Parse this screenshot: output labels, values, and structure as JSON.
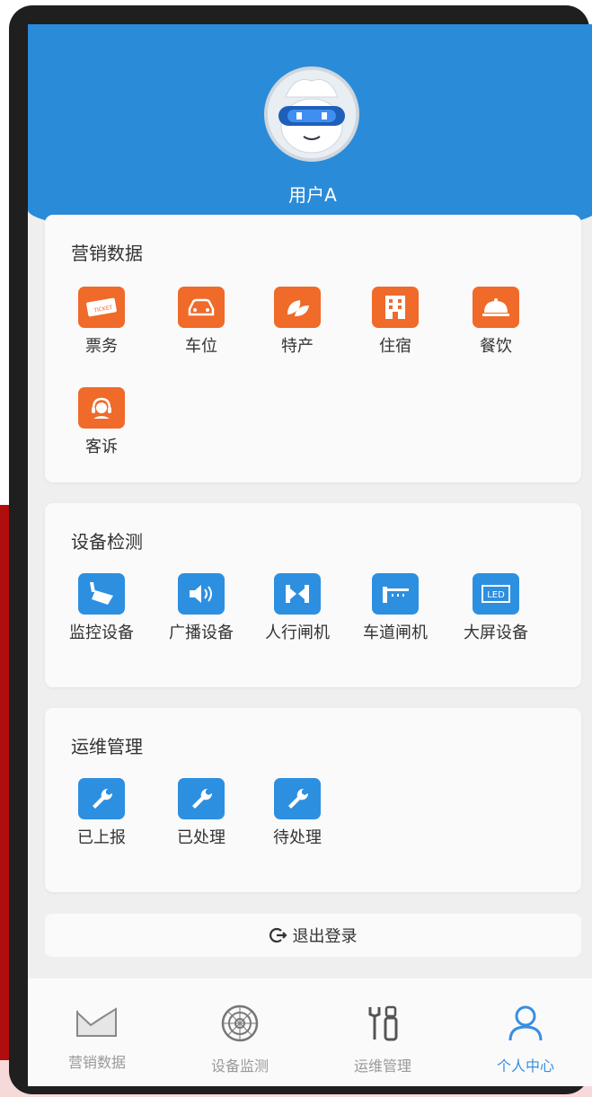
{
  "user": {
    "name": "用户A"
  },
  "sections": [
    {
      "title": "营销数据",
      "items": [
        {
          "label": "票务",
          "icon": "ticket-icon"
        },
        {
          "label": "车位",
          "icon": "car-icon"
        },
        {
          "label": "特产",
          "icon": "leaf-icon"
        },
        {
          "label": "住宿",
          "icon": "building-icon"
        },
        {
          "label": "餐饮",
          "icon": "food-cloche-icon"
        },
        {
          "label": "客诉",
          "icon": "headset-icon"
        }
      ]
    },
    {
      "title": "设备检测",
      "items": [
        {
          "label": "监控设备",
          "icon": "camera-icon"
        },
        {
          "label": "广播设备",
          "icon": "speaker-icon"
        },
        {
          "label": "人行闸机",
          "icon": "pedestrian-gate-icon"
        },
        {
          "label": "车道闸机",
          "icon": "barrier-gate-icon"
        },
        {
          "label": "大屏设备",
          "icon": "led-screen-icon",
          "badge": "LED"
        }
      ]
    },
    {
      "title": "运维管理",
      "items": [
        {
          "label": "已上报",
          "icon": "wrench-icon"
        },
        {
          "label": "已处理",
          "icon": "wrench-icon"
        },
        {
          "label": "待处理",
          "icon": "wrench-icon"
        }
      ]
    }
  ],
  "logout": {
    "label": "退出登录",
    "icon": "logout-icon"
  },
  "tabs": [
    {
      "label": "营销数据",
      "icon": "chart-icon",
      "active": false
    },
    {
      "label": "设备监测",
      "icon": "radar-icon",
      "active": false
    },
    {
      "label": "运维管理",
      "icon": "tools-icon",
      "active": false
    },
    {
      "label": "个人中心",
      "icon": "person-icon",
      "active": true
    }
  ],
  "colors": {
    "header": "#2a8bd9",
    "orange": "#f06a2a",
    "blue": "#2d8fe0",
    "tab_active": "#3a8ee0"
  }
}
